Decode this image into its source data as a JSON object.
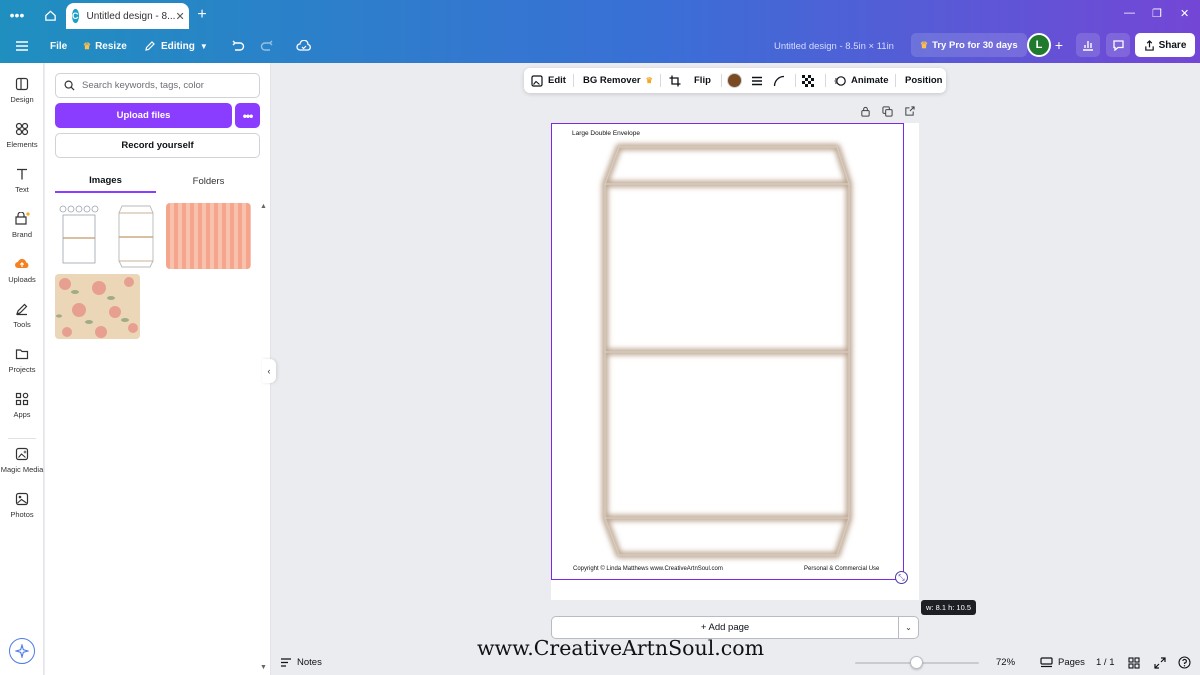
{
  "tab": {
    "title": "Untitled design - 8..."
  },
  "header": {
    "file_label": "File",
    "resize_label": "Resize",
    "editing_label": "Editing",
    "doc_title": "Untitled design - 8.5in × 11in",
    "try_pro_label": "Try Pro for 30 days",
    "avatar_initial": "L",
    "share_label": "Share"
  },
  "rail": {
    "items": [
      {
        "label": "Design"
      },
      {
        "label": "Elements"
      },
      {
        "label": "Text"
      },
      {
        "label": "Brand"
      },
      {
        "label": "Uploads"
      },
      {
        "label": "Tools"
      },
      {
        "label": "Projects"
      },
      {
        "label": "Apps"
      },
      {
        "label": "Magic Media"
      },
      {
        "label": "Photos"
      }
    ]
  },
  "panel": {
    "search_placeholder": "Search keywords, tags, color",
    "upload_label": "Upload files",
    "record_label": "Record yourself",
    "tabs": [
      {
        "label": "Images"
      },
      {
        "label": "Folders"
      }
    ]
  },
  "context_toolbar": {
    "edit_label": "Edit",
    "bg_remover_label": "BG Remover",
    "flip_label": "Flip",
    "animate_label": "Animate",
    "position_label": "Position",
    "swatch_color": "#7a4a22"
  },
  "canvas": {
    "envelope_title": "Large Double Envelope",
    "copyright": "Copyright © Linda Matthews www.CreativeArtnSoul.com",
    "usage": "Personal & Commercial Use",
    "dimensions": "w: 8.1 h: 10.5",
    "add_page_label": "+ Add page"
  },
  "footer": {
    "notes_label": "Notes",
    "watermark": "www.CreativeArtnSoul.com",
    "zoom": "72%",
    "pages_label": "Pages",
    "page_count": "1 / 1"
  },
  "colors": {
    "accent": "#8b3dff",
    "selection": "#7d2ae8",
    "envelope_edge": "#b9a28c"
  }
}
